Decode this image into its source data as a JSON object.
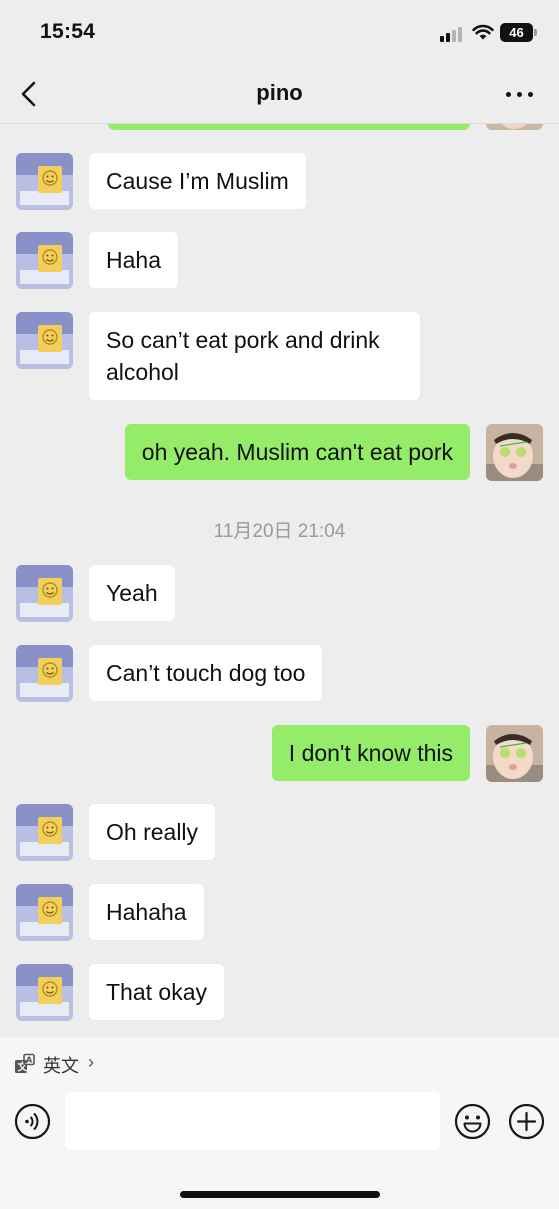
{
  "status_bar": {
    "time": "15:54",
    "battery": "46"
  },
  "nav": {
    "title": "pino"
  },
  "messages": [
    {
      "from": "them",
      "text": "Cause I’m Muslim"
    },
    {
      "from": "them",
      "text": "Haha"
    },
    {
      "from": "them",
      "text": "So can’t eat pork and drink alcohol"
    },
    {
      "from": "me",
      "text": "oh yeah. Muslim can't eat pork"
    },
    {
      "timestamp": "11月20日 21:04"
    },
    {
      "from": "them",
      "text": "Yeah"
    },
    {
      "from": "them",
      "text": "Can’t touch dog too"
    },
    {
      "from": "me",
      "text": "I don't know this"
    },
    {
      "from": "them",
      "text": "Oh really"
    },
    {
      "from": "them",
      "text": "Hahaha"
    },
    {
      "from": "them",
      "text": "That okay"
    }
  ],
  "translate_bar": {
    "label": "英文",
    "chevron": "›"
  },
  "input": {
    "value": ""
  },
  "colors": {
    "background": "#ededed",
    "outgoing_bubble": "#95ec69",
    "incoming_bubble": "#ffffff"
  },
  "icons": [
    "back-icon",
    "more-icon",
    "voice-icon",
    "emoji-icon",
    "plus-icon",
    "translate-icon",
    "wifi-icon",
    "signal-icon",
    "battery-icon"
  ]
}
